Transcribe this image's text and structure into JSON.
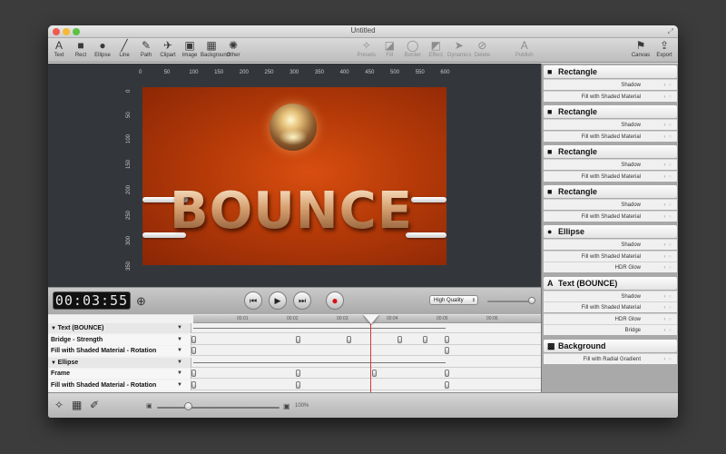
{
  "window": {
    "title": "Untitled"
  },
  "toolbar": {
    "left": [
      {
        "label": "Text",
        "icon": "text-tool-icon",
        "glyph": "A"
      },
      {
        "label": "Rect",
        "icon": "rect-tool-icon",
        "glyph": "■"
      },
      {
        "label": "Ellipse",
        "icon": "ellipse-tool-icon",
        "glyph": "●"
      },
      {
        "label": "Line",
        "icon": "line-tool-icon",
        "glyph": "╱"
      },
      {
        "label": "Path",
        "icon": "path-tool-icon",
        "glyph": "✎"
      },
      {
        "label": "Clipart",
        "icon": "clipart-tool-icon",
        "glyph": "✈"
      },
      {
        "label": "Image",
        "icon": "image-tool-icon",
        "glyph": "▣"
      },
      {
        "label": "Background",
        "icon": "background-tool-icon",
        "glyph": "▦"
      },
      {
        "label": "Other",
        "icon": "other-tool-icon",
        "glyph": "✺"
      }
    ],
    "middle": [
      {
        "label": "Presets",
        "icon": "presets-icon",
        "glyph": "✧"
      },
      {
        "label": "Fill",
        "icon": "fill-icon",
        "glyph": "◪"
      },
      {
        "label": "Border",
        "icon": "border-icon",
        "glyph": "◯"
      },
      {
        "label": "Effect",
        "icon": "effect-icon",
        "glyph": "◩"
      },
      {
        "label": "Dynamics",
        "icon": "dynamics-icon",
        "glyph": "➤"
      },
      {
        "label": "Delete",
        "icon": "delete-icon",
        "glyph": "⊘"
      },
      {
        "label": "Publish",
        "icon": "publish-icon",
        "glyph": "A"
      }
    ],
    "right": [
      {
        "label": "Canvas",
        "icon": "canvas-icon",
        "glyph": "⚑"
      },
      {
        "label": "Export",
        "icon": "export-icon",
        "glyph": "⇪"
      }
    ]
  },
  "ruler": {
    "h": [
      "0",
      "50",
      "100",
      "150",
      "200",
      "250",
      "300",
      "350",
      "400",
      "450",
      "500",
      "550",
      "600"
    ],
    "v": [
      "0",
      "50",
      "100",
      "150",
      "200",
      "250",
      "300",
      "350"
    ]
  },
  "canvas": {
    "text": "BOUNCE",
    "background_color": "#b53a08"
  },
  "transport": {
    "timecode": "00:03:55",
    "quality": "High Quality",
    "quality_fraction": 0.95
  },
  "timeline": {
    "ticks": [
      "00:01",
      "00:02",
      "00:03",
      "00:04",
      "00:05",
      "00:06"
    ],
    "rows": [
      {
        "label": "Text (BOUNCE)",
        "group": true
      },
      {
        "label": "Bridge - Strength",
        "group": false
      },
      {
        "label": "Fill with Shaded Material - Rotation",
        "group": false
      },
      {
        "label": "Ellipse",
        "group": true
      },
      {
        "label": "Frame",
        "group": false
      },
      {
        "label": "Fill with Shaded Material - Rotation",
        "group": false
      }
    ]
  },
  "panel": {
    "objects": [
      {
        "name": "Rectangle",
        "icon": "rectangle-icon",
        "props": [
          "Shadow",
          "Fill with Shaded Material"
        ]
      },
      {
        "name": "Rectangle",
        "icon": "rectangle-icon",
        "props": [
          "Shadow",
          "Fill with Shaded Material"
        ]
      },
      {
        "name": "Rectangle",
        "icon": "rectangle-icon",
        "props": [
          "Shadow",
          "Fill with Shaded Material"
        ]
      },
      {
        "name": "Rectangle",
        "icon": "rectangle-icon",
        "props": [
          "Shadow",
          "Fill with Shaded Material"
        ]
      },
      {
        "name": "Ellipse",
        "icon": "ellipse-icon",
        "props": [
          "Shadow",
          "Fill with Shaded Material",
          "HDR Glow"
        ]
      },
      {
        "name": "Text (BOUNCE)",
        "icon": "text-icon",
        "props": [
          "Shadow",
          "Fill with Shaded Material",
          "HDR Glow",
          "Bridge"
        ]
      },
      {
        "name": "Background",
        "icon": "background-icon",
        "props": [
          "Fill with Radial Gradient"
        ]
      }
    ]
  },
  "bottom": {
    "zoom": "100%"
  }
}
